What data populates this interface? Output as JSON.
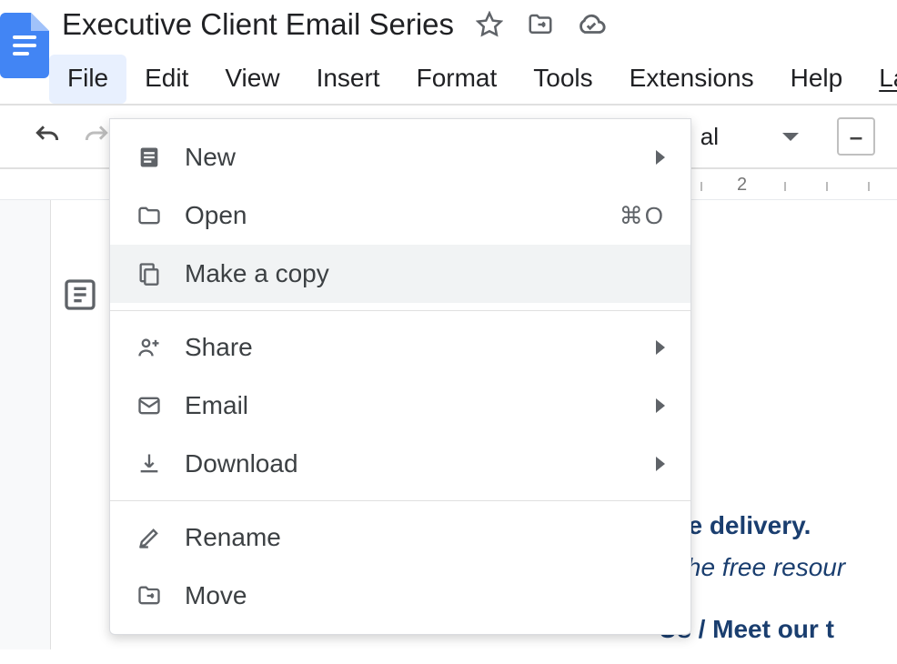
{
  "doc": {
    "title": "Executive Client Email Series"
  },
  "menubar": {
    "file": "File",
    "edit": "Edit",
    "view": "View",
    "insert": "Insert",
    "format": "Format",
    "tools": "Tools",
    "extensions": "Extensions",
    "help": "Help",
    "last": "La"
  },
  "toolbar": {
    "font_partial": "al",
    "minus": "–"
  },
  "ruler": {
    "mark2": "2"
  },
  "file_menu": {
    "new": "New",
    "open": "Open",
    "open_shortcut": "⌘O",
    "make_copy": "Make a copy",
    "share": "Share",
    "email": "Email",
    "download": "Download",
    "rename": "Rename",
    "move": "Move"
  },
  "body": {
    "line1": "rce delivery.",
    "line2": "r the free resour",
    "line3": " Us / Meet our t"
  }
}
